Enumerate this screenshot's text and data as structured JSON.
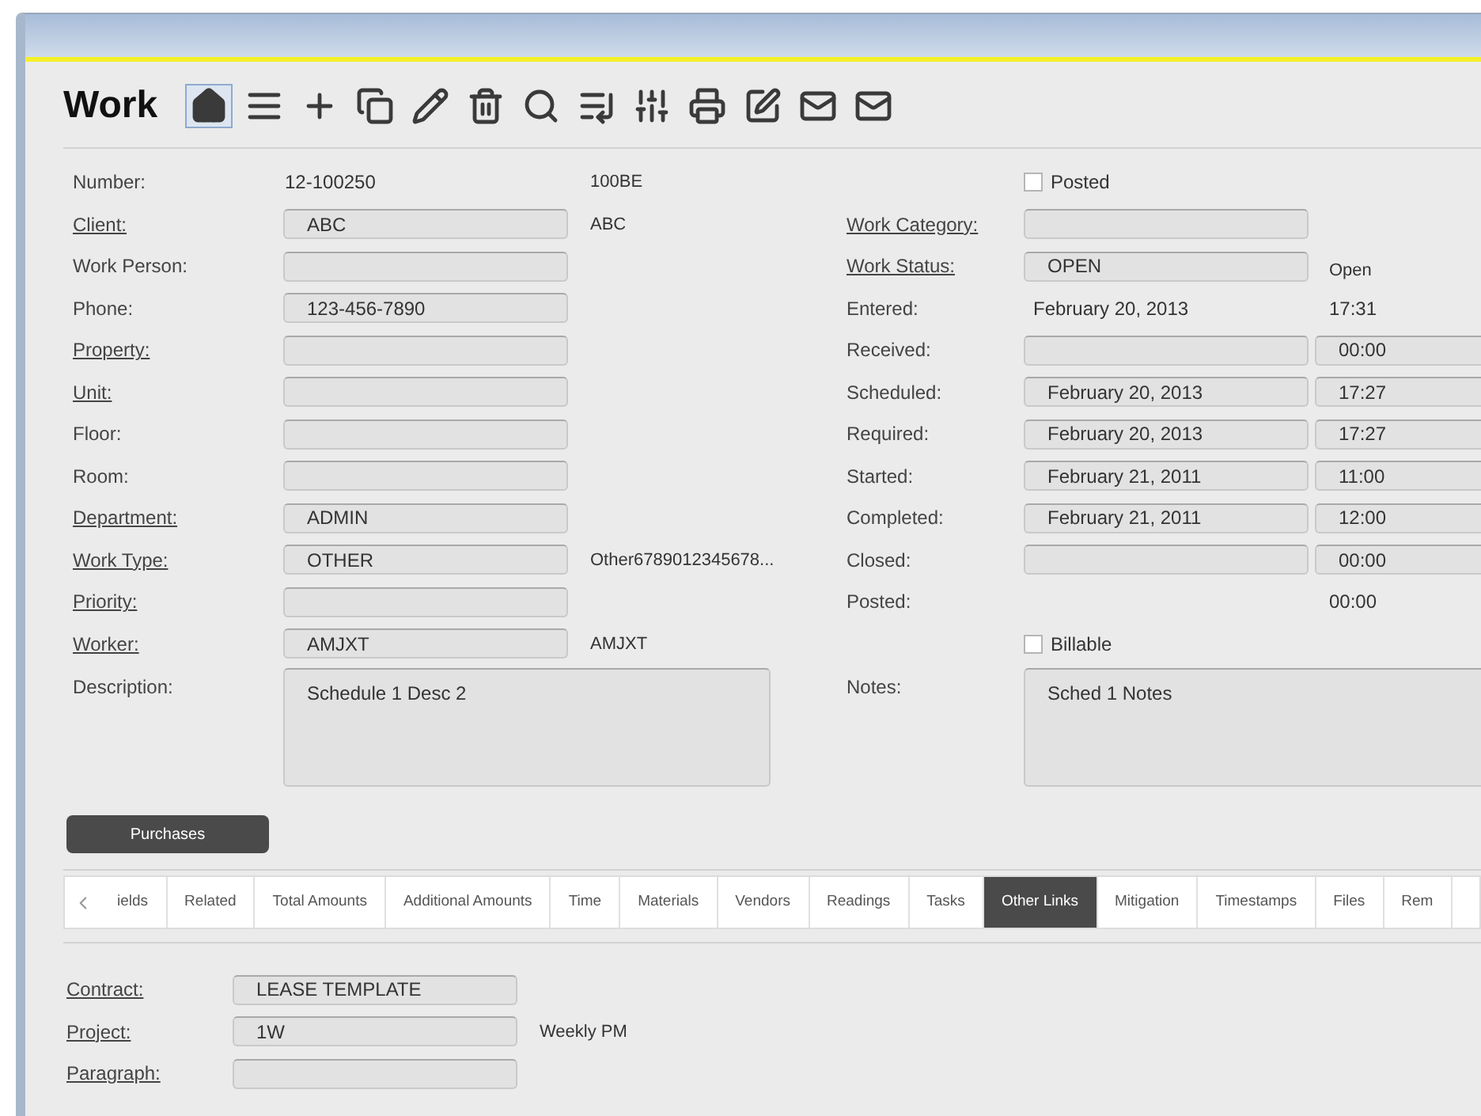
{
  "page": {
    "title": "Work"
  },
  "toolbar": [
    {
      "kind": "home",
      "selected": true
    },
    {
      "kind": "list",
      "selected": false
    },
    {
      "kind": "add",
      "selected": false
    },
    {
      "kind": "copy",
      "selected": false
    },
    {
      "kind": "edit",
      "selected": false
    },
    {
      "kind": "delete",
      "selected": false
    },
    {
      "kind": "search",
      "selected": false
    },
    {
      "kind": "save-list",
      "selected": false
    },
    {
      "kind": "columns",
      "selected": false
    },
    {
      "kind": "print",
      "selected": false
    },
    {
      "kind": "edit-box",
      "selected": false
    },
    {
      "kind": "mail-box",
      "selected": false
    },
    {
      "kind": "mail",
      "selected": false
    }
  ],
  "left_fields": [
    {
      "label": "Number:",
      "link": false,
      "kind": "text",
      "value": "12-100250",
      "extra": "100BE"
    },
    {
      "label": "Client:",
      "link": true,
      "kind": "field",
      "value": "ABC",
      "extra": "ABC"
    },
    {
      "label": "Work Person:",
      "link": false,
      "kind": "field"
    },
    {
      "label": "Phone:",
      "link": false,
      "kind": "field",
      "value": "123-456-7890"
    },
    {
      "label": "Property:",
      "link": true,
      "kind": "field"
    },
    {
      "label": "Unit:",
      "link": true,
      "kind": "field"
    },
    {
      "label": "Floor:",
      "link": false,
      "kind": "field"
    },
    {
      "label": "Room:",
      "link": false,
      "kind": "field"
    },
    {
      "label": "Department:",
      "link": true,
      "kind": "field",
      "value": "ADMIN"
    },
    {
      "label": "Work Type:",
      "link": true,
      "kind": "field",
      "value": "OTHER",
      "extra": "Other6789012345678..."
    },
    {
      "label": "Priority:",
      "link": true,
      "kind": "field"
    },
    {
      "label": "Worker:",
      "link": true,
      "kind": "field",
      "value": "AMJXT",
      "extra": "AMJXT"
    },
    {
      "label": "Description:",
      "link": false,
      "kind": "area",
      "value": "Schedule 1 Desc 2"
    }
  ],
  "right_fields": [
    {
      "kind": "checkbox",
      "label": "Posted",
      "checked": false
    },
    {
      "kind": "field",
      "label": "Work Category:",
      "link": true
    },
    {
      "kind": "field",
      "label": "Work Status:",
      "link": true,
      "value": "OPEN",
      "extra": "Open"
    },
    {
      "kind": "text",
      "label": "Entered:",
      "link": false,
      "value": "February 20, 2013",
      "time": "17:31",
      "time_boxed": false
    },
    {
      "kind": "field",
      "label": "Received:",
      "link": false,
      "time": "00:00",
      "time_boxed": true
    },
    {
      "kind": "field",
      "label": "Scheduled:",
      "link": false,
      "value": "February 20, 2013",
      "time": "17:27",
      "time_boxed": true
    },
    {
      "kind": "field",
      "label": "Required:",
      "link": false,
      "value": "February 20, 2013",
      "time": "17:27",
      "time_boxed": true
    },
    {
      "kind": "field",
      "label": "Started:",
      "link": false,
      "value": "February 21, 2011",
      "time": "11:00",
      "time_boxed": true
    },
    {
      "kind": "field",
      "label": "Completed:",
      "link": false,
      "value": "February 21, 2011",
      "time": "12:00",
      "time_boxed": true
    },
    {
      "kind": "field",
      "label": "Closed:",
      "link": false,
      "time": "00:00",
      "time_boxed": true
    },
    {
      "kind": "none",
      "label": "Posted:",
      "link": false,
      "time": "00:00",
      "time_boxed": false
    },
    {
      "kind": "checkbox",
      "label": "Billable",
      "checked": false
    },
    {
      "kind": "area",
      "label": "Notes:",
      "link": false,
      "value": "Sched 1 Notes"
    }
  ],
  "purchases_button": "Purchases",
  "tabs": [
    {
      "label": "ields",
      "selected": false
    },
    {
      "label": "Related",
      "selected": false
    },
    {
      "label": "Total Amounts",
      "selected": false
    },
    {
      "label": "Additional Amounts",
      "selected": false
    },
    {
      "label": "Time",
      "selected": false
    },
    {
      "label": "Materials",
      "selected": false
    },
    {
      "label": "Vendors",
      "selected": false
    },
    {
      "label": "Readings",
      "selected": false
    },
    {
      "label": "Tasks",
      "selected": false
    },
    {
      "label": "Other Links",
      "selected": true
    },
    {
      "label": "Mitigation",
      "selected": false
    },
    {
      "label": "Timestamps",
      "selected": false
    },
    {
      "label": "Files",
      "selected": false
    },
    {
      "label": "Rem",
      "selected": false
    }
  ],
  "other_links": [
    {
      "label": "Contract:",
      "link": true,
      "value": "LEASE TEMPLATE"
    },
    {
      "label": "Project:",
      "link": true,
      "value": "1W",
      "extra": "Weekly PM"
    },
    {
      "label": "Paragraph:",
      "link": true
    }
  ]
}
